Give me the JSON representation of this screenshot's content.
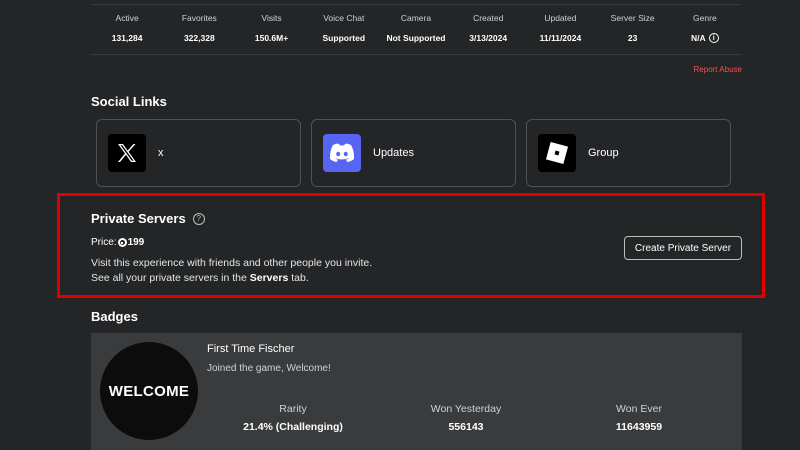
{
  "stats": [
    {
      "label": "Active",
      "value": "131,284"
    },
    {
      "label": "Favorites",
      "value": "322,328"
    },
    {
      "label": "Visits",
      "value": "150.6M+"
    },
    {
      "label": "Voice Chat",
      "value": "Supported"
    },
    {
      "label": "Camera",
      "value": "Not Supported"
    },
    {
      "label": "Created",
      "value": "3/13/2024"
    },
    {
      "label": "Updated",
      "value": "11/11/2024"
    },
    {
      "label": "Server Size",
      "value": "23"
    },
    {
      "label": "Genre",
      "value": "N/A"
    }
  ],
  "report_abuse": "Report Abuse",
  "social": {
    "title": "Social Links",
    "links": [
      {
        "label": "x",
        "icon": "x-logo-icon"
      },
      {
        "label": "Updates",
        "icon": "discord-logo-icon"
      },
      {
        "label": "Group",
        "icon": "roblox-logo-icon"
      }
    ]
  },
  "private_servers": {
    "title": "Private Servers",
    "price_label": "Price:",
    "price_value": "199",
    "desc_line1": "Visit this experience with friends and other people you invite.",
    "desc_line2_pre": "See all your private servers in the ",
    "desc_line2_bold": "Servers",
    "desc_line2_post": " tab.",
    "create_button": "Create Private Server"
  },
  "badges": {
    "title": "Badges",
    "items": [
      {
        "image_text": "WELCOME",
        "name": "First Time Fischer",
        "description": "Joined the game, Welcome!",
        "stats": [
          {
            "label": "Rarity",
            "value": "21.4% (Challenging)"
          },
          {
            "label": "Won Yesterday",
            "value": "556143"
          },
          {
            "label": "Won Ever",
            "value": "11643959"
          }
        ]
      }
    ]
  },
  "colors": {
    "background": "#232527",
    "highlight_border": "#e00000",
    "report": "#ff4d4d",
    "discord": "#5865f2"
  }
}
